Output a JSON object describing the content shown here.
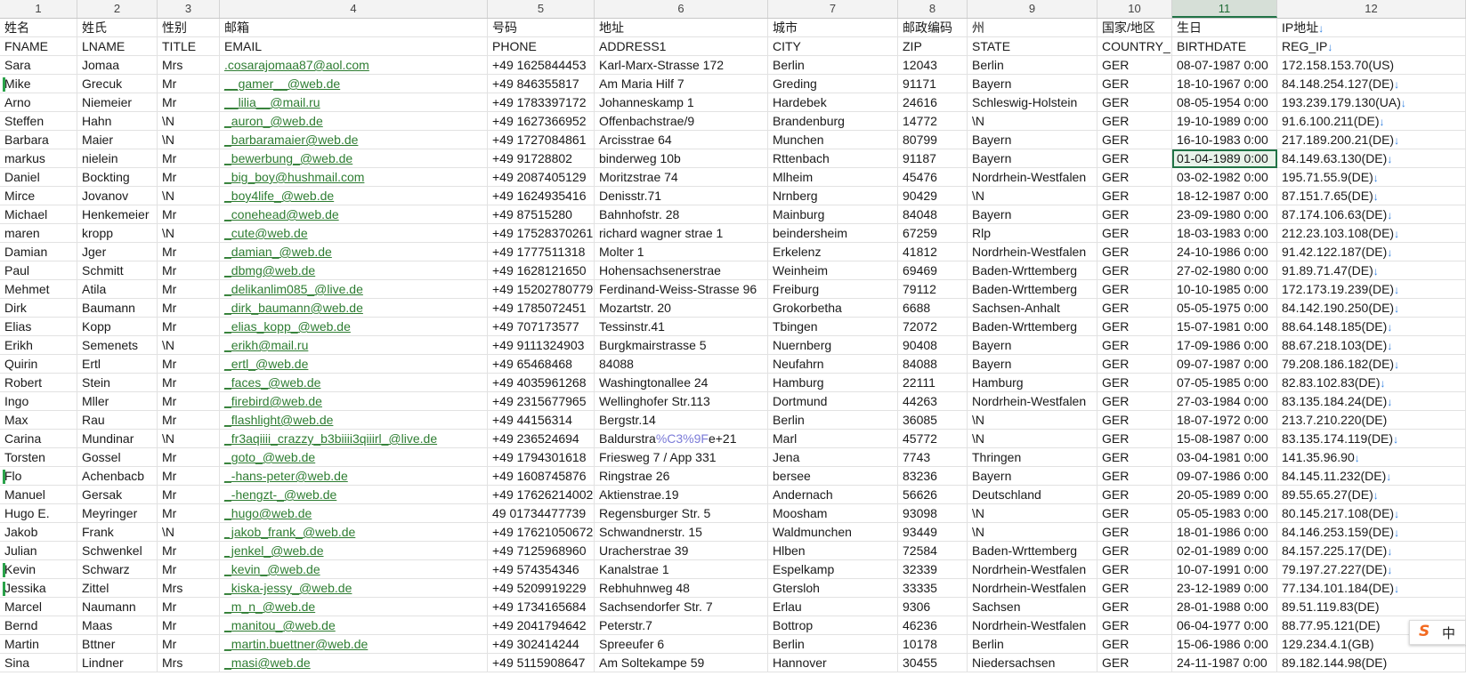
{
  "colors": {
    "link": "#2e7d32",
    "selection": "#217346",
    "row_flag": "#2aa34a",
    "arrow": "#2f7fe0",
    "encoded": "#7b7bd8"
  },
  "ime": {
    "brand_icon": "sogou-s-icon",
    "label": "中"
  },
  "column_numbers": [
    "1",
    "2",
    "3",
    "4",
    "5",
    "6",
    "7",
    "8",
    "9",
    "10",
    "11",
    "12"
  ],
  "active_column": 10,
  "header_cn": [
    "姓名",
    "姓氏",
    "性别",
    "邮箱",
    "号码",
    "地址",
    "城市",
    "邮政编码",
    "州",
    "国家/地区",
    "生日",
    "IP地址"
  ],
  "header_en": [
    "FNAME",
    "LNAME",
    "TITLE",
    "EMAIL",
    "PHONE",
    "ADDRESS1",
    "CITY",
    "ZIP",
    "STATE",
    "COUNTRY_ID",
    "BIRTHDATE",
    "REG_IP"
  ],
  "rows": [
    [
      "Sara",
      "Jomaa",
      "Mrs",
      ".cosarajomaa87@aol.com",
      "+49 1625844453",
      "Karl-Marx-Strasse 172",
      "Berlin",
      "12043",
      "Berlin",
      "GER",
      "08-07-1987 0:00",
      "172.158.153.70(US)"
    ],
    [
      "Mike",
      "Grecuk",
      "Mr",
      "__gamer__@web.de",
      "+49 846355817",
      "Am Maria Hilf 7",
      "Greding",
      "91171",
      "Bayern",
      "GER",
      "18-10-1967 0:00",
      "84.148.254.127(DE)"
    ],
    [
      "Arno",
      "Niemeier",
      "Mr",
      "__lilia__@mail.ru",
      "+49 1783397172",
      "Johanneskamp 1",
      "Hardebek",
      "24616",
      "Schleswig-Holstein",
      "GER",
      "08-05-1954 0:00",
      "193.239.179.130(UA)"
    ],
    [
      "Steffen",
      "Hahn",
      "\\N",
      "_auron_@web.de",
      "+49 1627366952",
      "Offenbachstrae/9",
      "Brandenburg",
      "14772",
      "\\N",
      "GER",
      "19-10-1989 0:00",
      "91.6.100.211(DE)"
    ],
    [
      "Barbara",
      "Maier",
      "\\N",
      "_barbaramaier@web.de",
      "+49 1727084861",
      "Arcisstrae 64",
      "Munchen",
      "80799",
      "Bayern",
      "GER",
      "16-10-1983 0:00",
      "217.189.200.21(DE)"
    ],
    [
      "markus",
      "nielein",
      "Mr",
      "_bewerbung_@web.de",
      "+49 91728802",
      "binderweg 10b",
      "Rttenbach",
      "91187",
      "Bayern",
      "GER",
      "01-04-1989 0:00",
      "84.149.63.130(DE)"
    ],
    [
      "Daniel",
      "Bockting",
      "Mr",
      "_big_boy@hushmail.com",
      "+49 2087405129",
      "Moritzstrae 74",
      "Mlheim",
      "45476",
      "Nordrhein-Westfalen",
      "GER",
      "03-02-1982 0:00",
      "195.71.55.9(DE)"
    ],
    [
      "Mirce",
      "Jovanov",
      "\\N",
      "_boy4life_@web.de",
      "+49 1624935416",
      "Denisstr.71",
      "Nrnberg",
      "90429",
      "\\N",
      "GER",
      "18-12-1987 0:00",
      "87.151.7.65(DE)"
    ],
    [
      "Michael",
      "Henkemeier",
      "Mr",
      "_conehead@web.de",
      "+49 87515280",
      "Bahnhofstr. 28",
      "Mainburg",
      "84048",
      "Bayern",
      "GER",
      "23-09-1980 0:00",
      "87.174.106.63(DE)"
    ],
    [
      "maren",
      "kropp",
      "\\N",
      "_cute@web.de",
      "+49 17528370261",
      "richard wagner strae 1",
      "beindersheim",
      "67259",
      "Rlp",
      "GER",
      "18-03-1983 0:00",
      "212.23.103.108(DE)"
    ],
    [
      "Damian",
      "Jger",
      "Mr",
      "_damian_@web.de",
      "+49 1777511318",
      "Molter 1",
      "Erkelenz",
      "41812",
      "Nordrhein-Westfalen",
      "GER",
      "24-10-1986 0:00",
      "91.42.122.187(DE)"
    ],
    [
      "Paul",
      "Schmitt",
      "Mr",
      "_dbmg@web.de",
      "+49 1628121650",
      "Hohensachsenerstrae",
      "Weinheim",
      "69469",
      "Baden-Wrttemberg",
      "GER",
      "27-02-1980 0:00",
      "91.89.71.47(DE)"
    ],
    [
      "Mehmet",
      "Atila",
      "Mr",
      "_delikanlim085_@live.de",
      "+49 15202780779",
      "Ferdinand-Weiss-Strasse 96",
      "Freiburg",
      "79112",
      "Baden-Wrttemberg",
      "GER",
      "10-10-1985 0:00",
      "172.173.19.239(DE)"
    ],
    [
      "Dirk",
      "Baumann",
      "Mr",
      "_dirk_baumann@web.de",
      "+49 1785072451",
      "Mozartstr. 20",
      "Grokorbetha",
      "6688",
      "Sachsen-Anhalt",
      "GER",
      "05-05-1975 0:00",
      "84.142.190.250(DE)"
    ],
    [
      "Elias",
      "Kopp",
      "Mr",
      "_elias_kopp_@web.de",
      "+49 707173577",
      "Tessinstr.41",
      "Tbingen",
      "72072",
      "Baden-Wrttemberg",
      "GER",
      "15-07-1981 0:00",
      "88.64.148.185(DE)"
    ],
    [
      "Erikh",
      "Semenets",
      "\\N",
      "_erikh@mail.ru",
      "+49 9111324903",
      "Burgkmairstrasse 5",
      "Nuernberg",
      "90408",
      "Bayern",
      "GER",
      "17-09-1986 0:00",
      "88.67.218.103(DE)"
    ],
    [
      "Quirin",
      "Ertl",
      "Mr",
      "_ertl_@web.de",
      "+49 65468468",
      "84088",
      "Neufahrn",
      "84088",
      "Bayern",
      "GER",
      "09-07-1987 0:00",
      "79.208.186.182(DE)"
    ],
    [
      "Robert",
      "Stein",
      "Mr",
      "_faces_@web.de",
      "+49 4035961268",
      "Washingtonallee 24",
      "Hamburg",
      "22111",
      "Hamburg",
      "GER",
      "07-05-1985 0:00",
      "82.83.102.83(DE)"
    ],
    [
      "Ingo",
      "Mller",
      "Mr",
      "_firebird@web.de",
      "+49 2315677965",
      "Wellinghofer Str.113",
      "Dortmund",
      "44263",
      "Nordrhein-Westfalen",
      "GER",
      "27-03-1984 0:00",
      "83.135.184.24(DE)"
    ],
    [
      "Max",
      "Rau",
      "Mr",
      "_flashlight@web.de",
      "+49 44156314",
      "Bergstr.14",
      "Berlin",
      "36085",
      "\\N",
      "GER",
      "18-07-1972 0:00",
      "213.7.210.220(DE)"
    ],
    [
      "Carina",
      "Mundinar",
      "\\N",
      "_fr3aqiiii_crazzy_b3biiii3qiiirl_@live.de",
      "+49 236524694",
      "Baldurstra%C3%9Fe+21",
      "Marl",
      "45772",
      "\\N",
      "GER",
      "15-08-1987 0:00",
      "83.135.174.119(DE)"
    ],
    [
      "Torsten",
      "Gossel",
      "Mr",
      "_goto_@web.de",
      "+49 1794301618",
      "Friesweg 7 / App 331",
      "Jena",
      "7743",
      "Thringen",
      "GER",
      "03-04-1981 0:00",
      "141.35.96.90"
    ],
    [
      "Flo",
      "Achenbacb",
      "Mr",
      "_-hans-peter@web.de",
      "+49 1608745876",
      "Ringstrae 26",
      "bersee",
      "83236",
      "Bayern",
      "GER",
      "09-07-1986 0:00",
      "84.145.11.232(DE)"
    ],
    [
      "Manuel",
      "Gersak",
      "Mr",
      "_-hengzt-_@web.de",
      "+49 17626214002",
      "Aktienstrae.19",
      "Andernach",
      "56626",
      "Deutschland",
      "GER",
      "20-05-1989 0:00",
      "89.55.65.27(DE)"
    ],
    [
      "Hugo E.",
      "Meyringer",
      "Mr",
      "_hugo@web.de",
      "49 01734477739",
      "Regensburger Str. 5",
      "Moosham",
      "93098",
      "\\N",
      "GER",
      "05-05-1983 0:00",
      "80.145.217.108(DE)"
    ],
    [
      "Jakob",
      "Frank",
      "\\N",
      "_jakob_frank_@web.de",
      "+49 17621050672",
      "Schwandnerstr. 15",
      "Waldmunchen",
      "93449",
      "\\N",
      "GER",
      "18-01-1986 0:00",
      "84.146.253.159(DE)"
    ],
    [
      "Julian",
      "Schwenkel",
      "Mr",
      "_jenkel_@web.de",
      "+49 7125968960",
      "Uracherstrae 39",
      "Hlben",
      "72584",
      "Baden-Wrttemberg",
      "GER",
      "02-01-1989 0:00",
      "84.157.225.17(DE)"
    ],
    [
      "Kevin",
      "Schwarz",
      "Mr",
      "_kevin_@web.de",
      "+49 574354346",
      "Kanalstrae 1",
      "Espelkamp",
      "32339",
      "Nordrhein-Westfalen",
      "GER",
      "10-07-1991 0:00",
      "79.197.27.227(DE)"
    ],
    [
      "Jessika",
      "Zittel",
      "Mrs",
      "_kiska-jessy_@web.de",
      "+49 5209919229",
      "Rebhuhnweg 48",
      "Gtersloh",
      "33335",
      "Nordrhein-Westfalen",
      "GER",
      "23-12-1989 0:00",
      "77.134.101.184(DE)"
    ],
    [
      "Marcel",
      "Naumann",
      "Mr",
      "_m_n_@web.de",
      "+49 1734165684",
      "Sachsendorfer Str. 7",
      "Erlau",
      "9306",
      "Sachsen",
      "GER",
      "28-01-1988 0:00",
      "89.51.119.83(DE)"
    ],
    [
      "Bernd",
      "Maas",
      "Mr",
      "_manitou_@web.de",
      "+49 2041794642",
      "Peterstr.7",
      "Bottrop",
      "46236",
      "Nordrhein-Westfalen",
      "GER",
      "06-04-1977 0:00",
      "88.77.95.121(DE)"
    ],
    [
      "Martin",
      "Bttner",
      "Mr",
      "_martin.buettner@web.de",
      "+49 302414244",
      "Spreeufer 6",
      "Berlin",
      "10178",
      "Berlin",
      "GER",
      "15-06-1986 0:00",
      "129.234.4.1(GB)"
    ],
    [
      "Sina",
      "Lindner",
      "Mrs",
      "_masi@web.de",
      "+49 5115908647",
      "Am Soltekampe 59",
      "Hannover",
      "30455",
      "Niedersachsen",
      "GER",
      "24-11-1987 0:00",
      "89.182.144.98(DE)"
    ]
  ],
  "flagged_rows": [
    1,
    22,
    27,
    28
  ],
  "selected": {
    "row": 5,
    "col": 10
  },
  "arrow_rows": [
    3,
    4,
    5,
    6,
    7,
    8,
    9,
    10,
    11,
    12,
    13,
    14,
    15,
    16,
    17,
    18,
    19,
    20,
    22,
    23,
    24,
    25,
    26,
    27,
    28,
    29,
    30
  ]
}
